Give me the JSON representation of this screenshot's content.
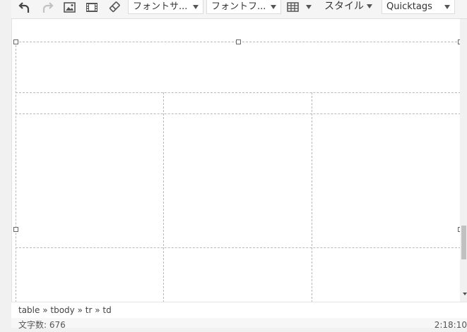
{
  "toolbar": {
    "undo_icon": "undo-arrow",
    "redo_icon": "redo-arrow",
    "image_icon": "image",
    "video_icon": "film",
    "eraser_icon": "eraser",
    "font_size_label": "フォントサ...",
    "font_family_label": "フォントフ...",
    "table_icon": "table-grid",
    "style_label": "スタイル",
    "quicktags_label": "Quicktags"
  },
  "statusbar": {
    "path": [
      "table",
      "tbody",
      "tr",
      "td"
    ],
    "separator": "»",
    "word_count": "文字数: 676",
    "time": "2:18:10"
  }
}
